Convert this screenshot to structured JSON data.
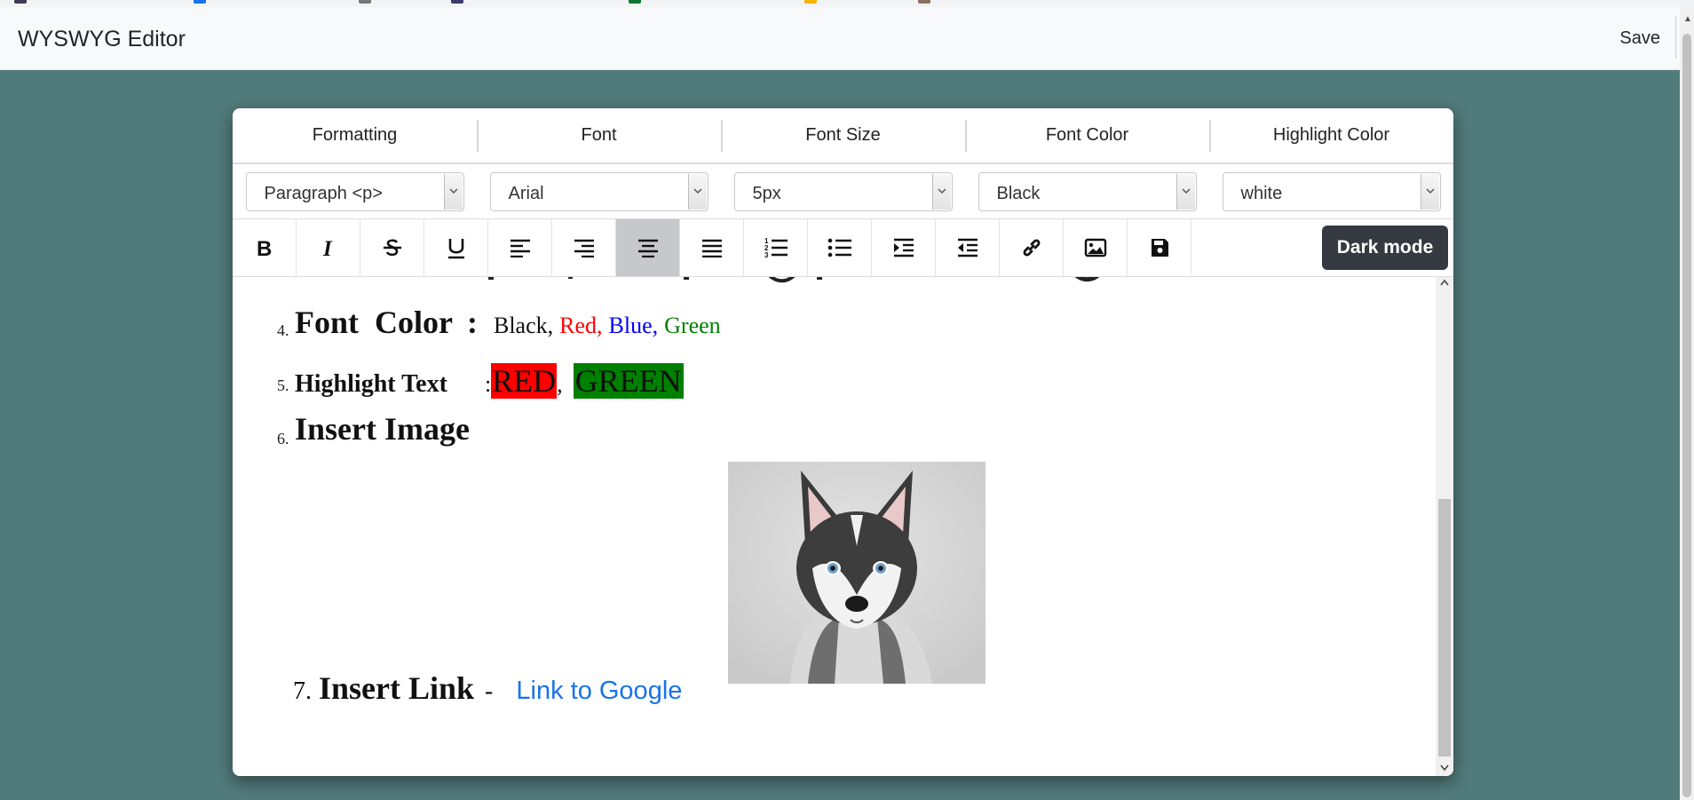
{
  "navbar": {
    "brand": "WYSWYG Editor",
    "save_label": "Save"
  },
  "tabs": [
    "Formatting",
    "Font",
    "Font Size",
    "Font Color",
    "Highlight Color"
  ],
  "selects": [
    {
      "name": "format-select",
      "value": "Paragraph <p>"
    },
    {
      "name": "font-select",
      "value": "Arial"
    },
    {
      "name": "font-size-select",
      "value": "5px"
    },
    {
      "name": "font-color-select",
      "value": "Black"
    },
    {
      "name": "highlight-color-select",
      "value": "white"
    }
  ],
  "toolbar": {
    "buttons": [
      "bold-icon",
      "italic-icon",
      "strikethrough-icon",
      "underline-icon",
      "align-left-icon",
      "align-right-icon",
      "align-center-icon",
      "align-justify-icon",
      "ordered-list-icon",
      "unordered-list-icon",
      "indent-icon",
      "outdent-icon",
      "link-icon",
      "image-icon",
      "save-icon"
    ],
    "active": "align-center-icon",
    "dark_mode_label": "Dark mode"
  },
  "content": {
    "item4": {
      "number": "4.",
      "label": "Font  Color",
      "colon": ":",
      "parts": [
        {
          "text": "Black,",
          "color": "#111111"
        },
        {
          "text": "Red,",
          "color": "#ff0000"
        },
        {
          "text": "Blue,",
          "color": "#0000ff"
        },
        {
          "text": "Green",
          "color": "#008000"
        }
      ]
    },
    "item5": {
      "number": "5.",
      "label": "Highlight Text",
      "colon": ":",
      "red_text": "RED",
      "comma": ",",
      "green_text": "GREEN",
      "red_bg": "#ff0000",
      "green_bg": "#008000"
    },
    "item6": {
      "number": "6.",
      "label": "Insert Image",
      "image": "husky-puppy-photo"
    },
    "item7": {
      "number": "7.",
      "label": "Insert Link",
      "dash": "-",
      "link_text": "Link to Google",
      "link_color": "#1a73e8"
    }
  }
}
